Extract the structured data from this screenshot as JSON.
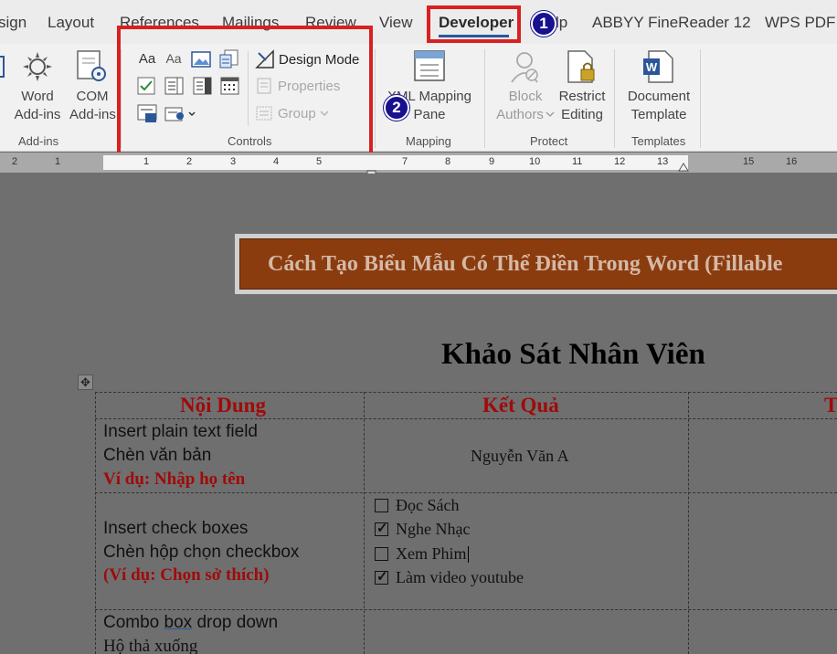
{
  "ribbon_tabs": [
    {
      "label": "sign"
    },
    {
      "label": "Layout"
    },
    {
      "label": "References"
    },
    {
      "label": "Mailings"
    },
    {
      "label": "Review"
    },
    {
      "label": "View"
    },
    {
      "label": "Developer"
    },
    {
      "label": "lp"
    },
    {
      "label": "ABBYY FineReader 12"
    },
    {
      "label": "WPS PDF"
    }
  ],
  "badges": {
    "one": "1",
    "two": "2"
  },
  "addins": {
    "word_addins_line1": "Word",
    "word_addins_line2": "Add-ins",
    "com_addins_line1": "COM",
    "com_addins_line2": "Add-ins",
    "group_label": "Add-ins"
  },
  "controls": {
    "design_mode": "Design Mode",
    "properties": "Properties",
    "group": "Group",
    "group_label": "Controls",
    "rich_text_glyph": "Aa",
    "plain_text_glyph": "Aa"
  },
  "mapping": {
    "line1": "XML Mapping",
    "line2": "Pane",
    "group_label": "Mapping"
  },
  "protect": {
    "block_line1": "Block",
    "block_line2": "Authors",
    "restrict_line1": "Restrict",
    "restrict_line2": "Editing",
    "group_label": "Protect"
  },
  "templates": {
    "line1": "Document",
    "line2": "Template",
    "group_label": "Templates"
  },
  "ruler": {
    "numbers": [
      "2",
      "1",
      "1",
      "2",
      "3",
      "4",
      "5",
      "7",
      "8",
      "9",
      "10",
      "11",
      "12",
      "13",
      "15",
      "16"
    ]
  },
  "document": {
    "banner": "Cách Tạo Biểu Mẫu Có Thể Điền Trong Word (Fillable",
    "title": "Khảo Sát Nhân Viên",
    "table": {
      "headers": [
        "Nội Dung",
        "Kết Quả",
        "T"
      ],
      "row1": {
        "line1": "Insert plain text field",
        "line2": "Chèn văn bản",
        "example": "Ví dụ: Nhập họ tên",
        "result": "Nguyễn Văn A"
      },
      "row2": {
        "line1": "Insert check boxes",
        "line2": "Chèn hộp chọn checkbox",
        "example": "(Ví dụ: Chọn sở thích)",
        "options": [
          {
            "label": "Đọc Sách",
            "checked": false
          },
          {
            "label": "Nghe Nhạc",
            "checked": true
          },
          {
            "label": "Xem Phim",
            "checked": false
          },
          {
            "label": "Làm video youtube",
            "checked": true
          }
        ]
      },
      "row3": {
        "line1_a": "Combo ",
        "line1_b": "box",
        "line1_c": " drop down",
        "line2": "Hộ thả xuống"
      }
    }
  }
}
